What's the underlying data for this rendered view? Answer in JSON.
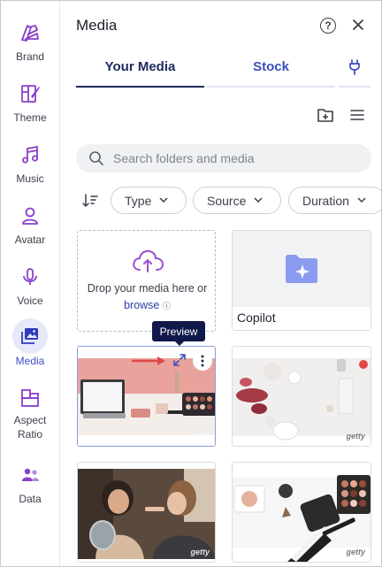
{
  "sidebar": {
    "items": [
      {
        "label": "Brand",
        "icon": "brand-icon"
      },
      {
        "label": "Theme",
        "icon": "theme-icon"
      },
      {
        "label": "Music",
        "icon": "music-icon"
      },
      {
        "label": "Avatar",
        "icon": "avatar-icon"
      },
      {
        "label": "Voice",
        "icon": "voice-icon"
      },
      {
        "label": "Media",
        "icon": "media-icon",
        "active": true
      },
      {
        "label": "Aspect Ratio",
        "icon": "aspect-ratio-icon"
      },
      {
        "label": "Data",
        "icon": "data-icon"
      }
    ]
  },
  "header": {
    "title": "Media",
    "help_symbol": "?"
  },
  "tabs": [
    {
      "label": "Your Media",
      "active": true
    },
    {
      "label": "Stock"
    },
    {
      "icon": "plug-icon"
    }
  ],
  "search": {
    "placeholder": "Search folders and media"
  },
  "filters": {
    "chips": [
      "Type",
      "Source",
      "Duration"
    ]
  },
  "drop_zone": {
    "text": "Drop your media here or",
    "link": "browse",
    "info_symbol": "ⓘ"
  },
  "folder": {
    "name": "Copilot"
  },
  "tooltip": {
    "label": "Preview"
  },
  "watermark": "getty",
  "colors": {
    "accent": "#3a4fbd",
    "active_tab": "#1b2a5c",
    "sidebar_active_bg": "#e7e9fa",
    "tooltip_bg": "#10194a"
  }
}
